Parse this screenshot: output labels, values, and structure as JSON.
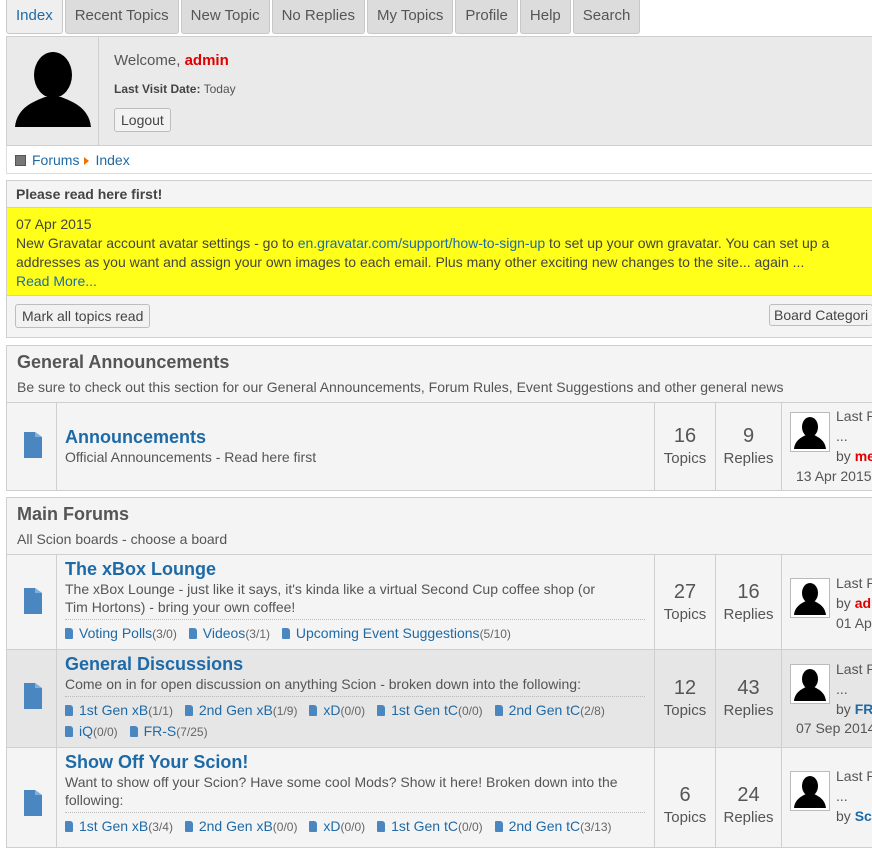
{
  "tabs": [
    "Index",
    "Recent Topics",
    "New Topic",
    "No Replies",
    "My Topics",
    "Profile",
    "Help",
    "Search"
  ],
  "welcome": {
    "greeting": "Welcome,",
    "username": "admin",
    "last_visit_label": "Last Visit Date:",
    "last_visit_value": "Today",
    "logout_label": "Logout"
  },
  "breadcrumb": [
    "Forums",
    "Index"
  ],
  "notice": {
    "title": "Please read here first!",
    "date": "07 Apr 2015",
    "text_before_link": "New Gravatar account avatar settings - go to ",
    "link": "en.gravatar.com/support/how-to-sign-up",
    "text_after_link": " to set up your own gravatar. You can set up a",
    "line2": "addresses as you want and assign your own images to each email. Plus many other exciting new changes to the site... again ...",
    "read_more": "Read More..."
  },
  "actions": {
    "mark_read": "Mark all topics read",
    "board_categories": "Board Categori"
  },
  "categories": [
    {
      "title": "General Announcements",
      "desc": "Be sure to check out this section for our General Announcements, Forum Rules, Event Suggestions and other general news"
    },
    {
      "title": "Main Forums",
      "desc": "All Scion boards - choose a board"
    }
  ],
  "boards": [
    {
      "name": "Announcements",
      "desc": "Official Announcements - Read here first",
      "topics": "16",
      "topics_label": "Topics",
      "replies": "9",
      "replies_label": "Replies",
      "last_label": "Last P",
      "last_ellipsis": "...",
      "by": "by",
      "last_user": "me",
      "last_date": "13 Apr 2015",
      "children": []
    },
    {
      "name": "The xBox Lounge",
      "desc_lines": [
        "The xBox Lounge - just like it says, it's kinda like a virtual Second Cup coffee shop (or",
        "Tim Hortons) - bring your own coffee!"
      ],
      "topics": "27",
      "topics_label": "Topics",
      "replies": "16",
      "replies_label": "Replies",
      "last_label": "Last P",
      "by": "by",
      "last_user": "adr",
      "last_date": "01 Ap",
      "children": [
        {
          "name": "Voting Polls",
          "count": "(3/0)"
        },
        {
          "name": "Videos",
          "count": "(3/1)"
        },
        {
          "name": "Upcoming Event Suggestions",
          "count": "(5/10)"
        }
      ]
    },
    {
      "name": "General Discussions",
      "desc": "Come on in for open discussion on anything Scion - broken down into the following:",
      "topics": "12",
      "topics_label": "Topics",
      "replies": "43",
      "replies_label": "Replies",
      "last_label": "Last P",
      "last_ellipsis": "...",
      "by": "by",
      "last_user": "FR",
      "last_date": "07 Sep 2014",
      "children": [
        {
          "name": "1st Gen xB",
          "count": "(1/1)"
        },
        {
          "name": "2nd Gen xB",
          "count": "(1/9)"
        },
        {
          "name": "xD",
          "count": "(0/0)"
        },
        {
          "name": "1st Gen tC",
          "count": "(0/0)"
        },
        {
          "name": "2nd Gen tC",
          "count": "(2/8)"
        },
        {
          "name": "iQ",
          "count": "(0/0)"
        },
        {
          "name": "FR-S",
          "count": "(7/25)"
        }
      ]
    },
    {
      "name": "Show Off Your Scion!",
      "desc_lines": [
        "Want to show off your Scion? Have some cool Mods? Show it here! Broken down into the",
        "following:"
      ],
      "topics": "6",
      "topics_label": "Topics",
      "replies": "24",
      "replies_label": "Replies",
      "last_label": "Last P",
      "last_ellipsis": "...",
      "by": "by",
      "last_user": "Sc",
      "children": [
        {
          "name": "1st Gen xB",
          "count": "(3/4)"
        },
        {
          "name": "2nd Gen xB",
          "count": "(0/0)"
        },
        {
          "name": "xD",
          "count": "(0/0)"
        },
        {
          "name": "1st Gen tC",
          "count": "(0/0)"
        },
        {
          "name": "2nd Gen tC",
          "count": "(3/13)"
        }
      ]
    }
  ],
  "colors": {
    "link": "#1e6aa7",
    "user": "#e00000",
    "notice_bg": "#ffff1a"
  }
}
